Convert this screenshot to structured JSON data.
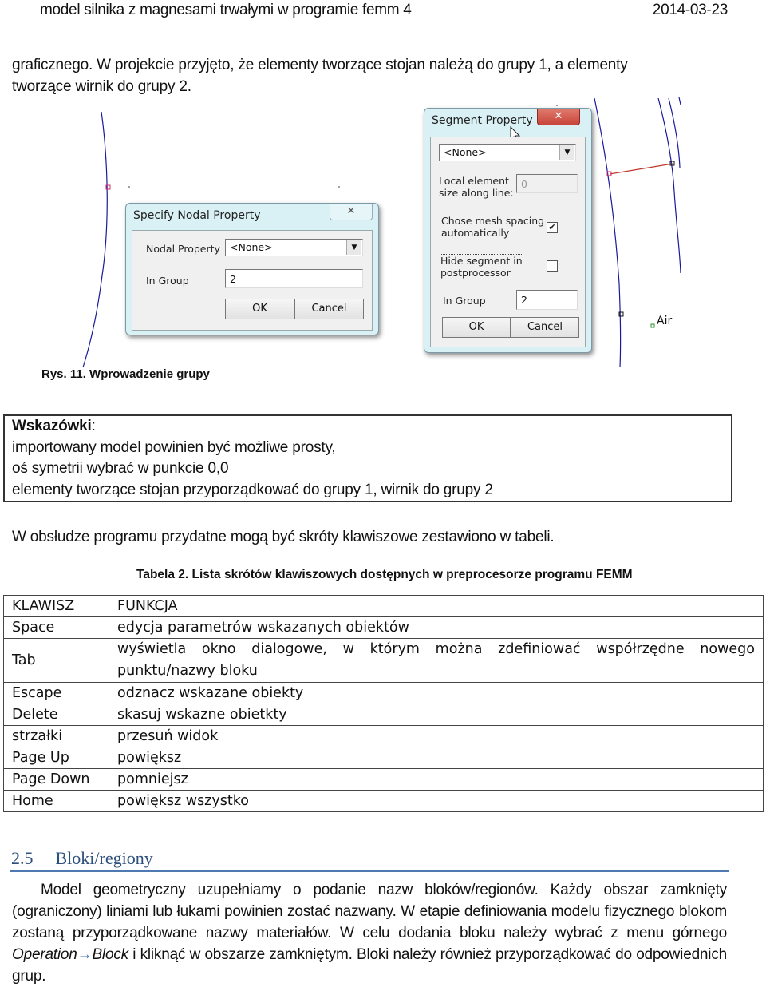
{
  "header": {
    "title": "model silnika z magnesami trwałymi w programie femm 4",
    "date": "2014-03-23"
  },
  "intro_paragraph": {
    "line1": "graficznego. W projekcie przyjęto, że elementy tworzące stojan należą do grupy 1, a elementy",
    "line2": "tworzące wirnik do grupy 2."
  },
  "figure": {
    "caption": "Rys. 11. Wprowadzenie grupy",
    "nodal_dialog": {
      "title": "Specify Nodal Property",
      "nodal_property_label": "Nodal Property",
      "nodal_property_value": "<None>",
      "in_group_label": "In Group",
      "in_group_value": "2",
      "ok_label": "OK",
      "cancel_label": "Cancel",
      "close_glyph": "✕"
    },
    "segment_dialog": {
      "title": "Segment Property",
      "property_value": "<None>",
      "local_size_label_1": "Local element",
      "local_size_label_2": "size along line:",
      "local_size_value": "0",
      "auto_mesh_label_1": "Chose mesh spacing",
      "auto_mesh_label_2": "automatically",
      "auto_mesh_checked": true,
      "hide_label_1": "Hide segment in",
      "hide_label_2": "postprocessor",
      "hide_checked": false,
      "in_group_label": "In Group",
      "in_group_value": "2",
      "ok_label": "OK",
      "cancel_label": "Cancel",
      "close_glyph": "✕"
    },
    "block_label": "Air",
    "colors": {
      "geometry_line": "#1a1a9c",
      "selected_segment": "#c0392b",
      "node_selected": "#d0306a",
      "block_marker": "#2e8b2e",
      "close_button_red": "#c8453a"
    }
  },
  "tips_box": {
    "title": "Wskazówki",
    "title_suffix": ":",
    "items": [
      "importowany model powinien być możliwe prosty,",
      "oś symetrii wybrać w punkcie 0,0",
      "elementy tworzące stojan przyporządkować do grupy 1, wirnik do grupy 2"
    ]
  },
  "shortcuts_intro": "W obsłudze programu przydatne mogą być skróty klawiszowe zestawiono w tabeli.",
  "table": {
    "caption": "Tabela 2. Lista skrótów klawiszowych dostępnych w preprocesorze programu FEMM",
    "headers": [
      "KLAWISZ",
      "FUNKCJA"
    ],
    "rows": [
      [
        "Space",
        "edycja parametrów wskazanych obiektów"
      ],
      [
        "Tab",
        "wyświetla okno dialogowe, w którym można zdefiniować współrzędne nowego punktu/nazwy bloku"
      ],
      [
        "Escape",
        "odznacz wskazane obiekty"
      ],
      [
        "Delete",
        "skasuj wskazne obietkty"
      ],
      [
        "strzałki",
        "przesuń widok"
      ],
      [
        "Page Up",
        "powiększ"
      ],
      [
        "Page Down",
        "pomniejsz"
      ],
      [
        "Home",
        "powiększ wszystko"
      ]
    ]
  },
  "section": {
    "number": "2.5",
    "title": "Bloki/regiony",
    "accent_color": "#4f79b1"
  },
  "section_paragraph": {
    "text_before_italic": "Model geometryczny uzupełniamy o podanie nazw bloków/regionów. Każdy obszar zamknięty (ograniczony) liniami lub łukami powinien zostać nazwany. W etapie definiowania modelu fizycznego blokom zostaną przyporządkowane nazwy materiałów. W celu dodania bloku należy wybrać z menu górnego ",
    "menu_path_1": "Operation",
    "arrow": "→",
    "menu_path_2": "Block",
    "text_after_italic": " i kliknąć w obszarze zamkniętym. Bloki należy również przyporządkować do odpowiednich grup."
  }
}
